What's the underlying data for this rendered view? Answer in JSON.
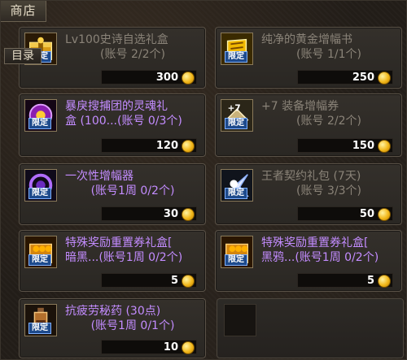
{
  "window": {
    "title": "商店"
  },
  "catalog_button": "目录",
  "items": [
    {
      "name": "Lv100史诗自选礼盒",
      "sub": "(账号 2/2个)",
      "price": "300",
      "limited": "限定",
      "icon": "gold-box-icon",
      "disabled": true
    },
    {
      "name": "纯净的黄金增幅书",
      "sub": "(账号 1/1个)",
      "price": "250",
      "limited": "限定",
      "icon": "gold-book-icon",
      "disabled": true
    },
    {
      "name": "暴戾搜捕团的灵魂礼",
      "sub": "盒 (100...(账号 0/3个)",
      "price": "120",
      "limited": "限定",
      "icon": "soul-box-icon",
      "disabled": false
    },
    {
      "name": "+7 装备增幅券",
      "sub": "(账号 2/2个)",
      "price": "150",
      "limited": "限定",
      "icon": "amplify-ticket-icon",
      "disabled": true
    },
    {
      "name": "一次性增幅器",
      "sub": "(账号1周 0/2个)",
      "price": "30",
      "limited": "限定",
      "icon": "amplifier-icon",
      "disabled": false
    },
    {
      "name": "王者契约礼包 (7天)",
      "sub": "(账号 3/3个)",
      "price": "50",
      "limited": "限定",
      "icon": "contract-pack-icon",
      "disabled": true
    },
    {
      "name": "特殊奖励重置券礼盒[",
      "sub": "暗黑...(账号1周 0/2个)",
      "price": "5",
      "limited": "限定",
      "icon": "reset-box-icon",
      "disabled": false
    },
    {
      "name": "特殊奖励重置券礼盒[",
      "sub": "黑鸦...(账号1周 0/2个)",
      "price": "5",
      "limited": "限定",
      "icon": "reset-box-icon",
      "disabled": false
    },
    {
      "name": "抗疲劳秘药 (30点)",
      "sub": "(账号1周 0/1个)",
      "price": "10",
      "limited": "限定",
      "icon": "potion-icon",
      "disabled": false
    }
  ]
}
